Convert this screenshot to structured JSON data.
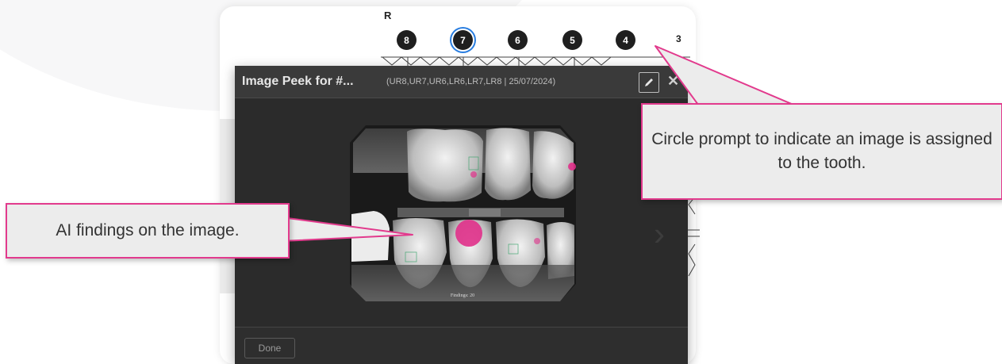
{
  "chart_header": {
    "quadrant_label": "R",
    "teeth": [
      "8",
      "7",
      "6",
      "5",
      "4",
      "3"
    ],
    "selected_tooth": "7"
  },
  "modal": {
    "title": "Image Peek for #...",
    "subtitle": "(UR8,UR7,UR6,LR6,LR7,LR8 | 25/07/2024)",
    "edit_icon": "pencil-icon",
    "close_icon": "close-icon",
    "image_caption": "Findings: 20",
    "done_label": "Done"
  },
  "callouts": {
    "findings": "AI findings on the image.",
    "circle_prompt": "Circle prompt to indicate an image is assigned to the tooth."
  },
  "colors": {
    "accent_pink": "#e23a8d",
    "selected_ring": "#2a7ee0",
    "modal_bg": "#2b2b2b",
    "finding_marker": "#e0308a"
  }
}
